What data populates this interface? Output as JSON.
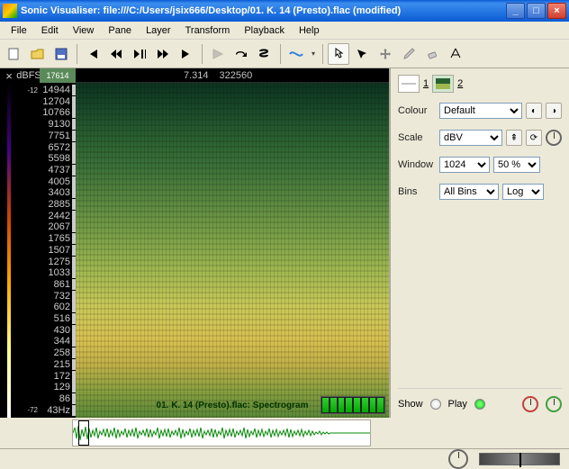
{
  "title": "Sonic Visualiser: file:///C:/Users/jsix666/Desktop/01. K. 14 (Presto).flac (modified)",
  "menus": [
    "File",
    "Edit",
    "View",
    "Pane",
    "Layer",
    "Transform",
    "Playback",
    "Help"
  ],
  "time": {
    "cursor": "7.314",
    "sample": "322560"
  },
  "scale": {
    "header": "dBFS",
    "labels": [
      "-12",
      "",
      "",
      "",
      "",
      "-72"
    ]
  },
  "freq": {
    "labels": [
      "17614",
      "14944",
      "12704",
      "10766",
      "9130",
      "7751",
      "6572",
      "5598",
      "4737",
      "4005",
      "3403",
      "2885",
      "2442",
      "2067",
      "1765",
      "1507",
      "1275",
      "1033",
      "861",
      "732",
      "602",
      "516",
      "430",
      "344",
      "258",
      "215",
      "172",
      "129",
      "86",
      "43Hz"
    ]
  },
  "speclabel": "01. K. 14 (Presto).flac: Spectrogram",
  "layertabs": [
    "1",
    "2"
  ],
  "props": {
    "colour": {
      "label": "Colour",
      "value": "Default"
    },
    "scale": {
      "label": "Scale",
      "value": "dBV"
    },
    "window": {
      "label": "Window",
      "value": "1024",
      "overlap": "50 %"
    },
    "bins": {
      "label": "Bins",
      "value": "All Bins",
      "type": "Log"
    }
  },
  "playback": {
    "show": "Show",
    "play": "Play"
  }
}
